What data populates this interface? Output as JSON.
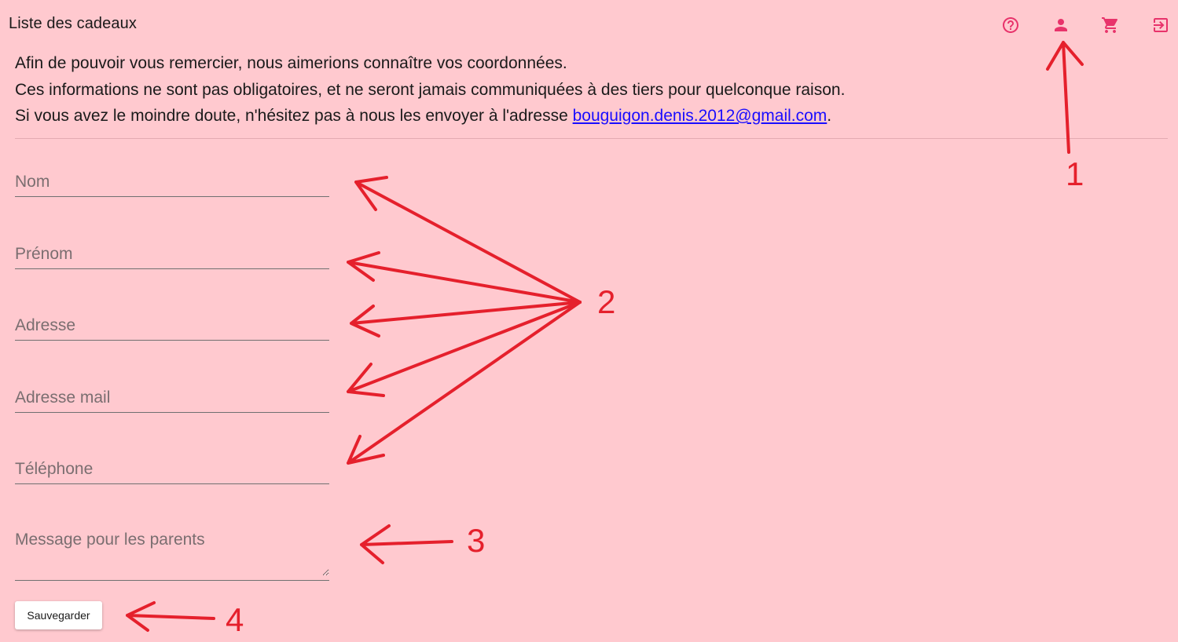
{
  "header": {
    "title": "Liste des cadeaux",
    "icons": [
      "help-circle-icon",
      "person-icon",
      "cart-icon",
      "logout-icon"
    ]
  },
  "intro": {
    "line1": "Afin de pouvoir vous remercier, nous aimerions connaître vos coordonnées.",
    "line2": "Ces informations ne sont pas obligatoires, et ne seront jamais communiquées à des tiers pour quelconque raison.",
    "line3_prefix": "Si vous avez le moindre doute, n'hésitez pas à nous les envoyer à l'adresse ",
    "email": "bouguigon.denis.2012@gmail.com",
    "line3_suffix": "."
  },
  "form": {
    "nom_placeholder": "Nom",
    "prenom_placeholder": "Prénom",
    "adresse_placeholder": "Adresse",
    "adresse_mail_placeholder": "Adresse mail",
    "telephone_placeholder": "Téléphone",
    "message_placeholder": "Message pour les parents",
    "save_label": "Sauvegarder"
  },
  "annotations": {
    "n1": "1",
    "n2": "2",
    "n3": "3",
    "n4": "4"
  },
  "colors": {
    "background": "#ffc9cf",
    "accent": "#e8336b",
    "annotation": "#e5202c",
    "link": "#1a0dff"
  }
}
